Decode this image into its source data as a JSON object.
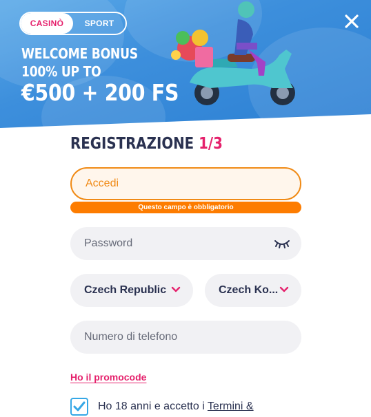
{
  "toggle": {
    "casino": "CASINÒ",
    "sport": "SPORT",
    "active": "casino"
  },
  "bonus": {
    "line1": "WELCOME BONUS",
    "line2": "100% UP TO",
    "line3": "€500 + 200 FS"
  },
  "form": {
    "title": "REGISTRAZIONE",
    "step": "1/3",
    "login_placeholder": "Accedi",
    "login_error": "Questo campo è obbligatorio",
    "password_placeholder": "Password",
    "country_value": "Czech Republic",
    "currency_value": "Czech Ko...",
    "phone_placeholder": "Numero di telefono",
    "promo_link": "Ho il promocode",
    "terms_text": "Ho 18 anni e accetto i ",
    "terms_link": "Termini &"
  },
  "colors": {
    "accent": "#e5216c",
    "error": "#fd7c00",
    "text": "#2a3150",
    "hero": "#3d8fdc"
  },
  "icons": {
    "close": "close-icon",
    "eye": "eye-closed-icon",
    "chevron": "chevron-down-icon",
    "check": "checkmark-icon"
  }
}
